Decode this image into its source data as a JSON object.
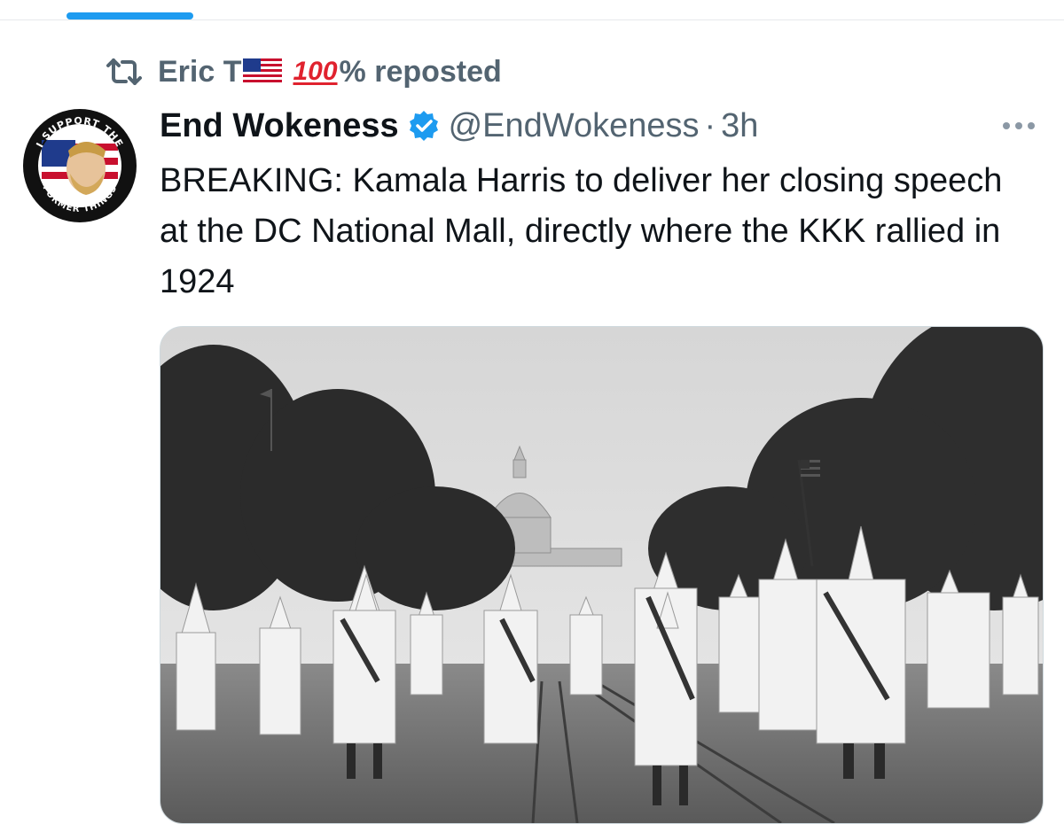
{
  "repost": {
    "name": "Eric T",
    "flag_icon": "us-flag-icon",
    "hundred_emoji": "100",
    "suffix": "% reposted",
    "icon": "repost-icon"
  },
  "tweet": {
    "author_name": "End Wokeness",
    "verified_icon": "verified-badge-icon",
    "handle": "@EndWokeness",
    "separator": "·",
    "time": "3h",
    "text": "BREAKING: Kamala Harris to deliver her closing speech at the DC National Mall, directly where the KKK rallied in 1924",
    "avatar": {
      "top_text": "I SUPPORT THE",
      "bottom_text": "FORMER THINGS"
    }
  },
  "colors": {
    "accent": "#1d9bf0",
    "secondary_text": "#536471",
    "primary_text": "#0f1419"
  }
}
